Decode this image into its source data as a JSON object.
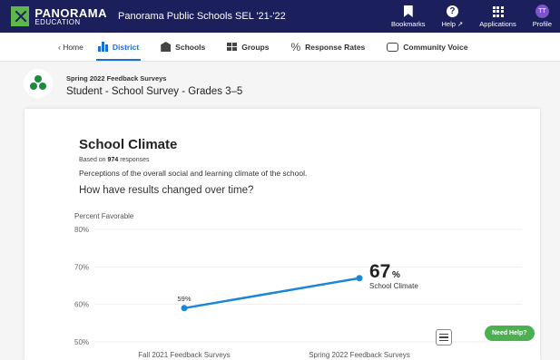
{
  "header": {
    "logo_name": "PANORAMA",
    "logo_sub": "EDUCATION",
    "app_title": "Panorama Public Schools SEL '21-'22",
    "nav": [
      {
        "label": "Bookmarks",
        "icon": "bookmark-icon"
      },
      {
        "label": "Help ↗",
        "icon": "help-icon"
      },
      {
        "label": "Applications",
        "icon": "apps-grid-icon"
      },
      {
        "label": "Profile",
        "icon": "avatar",
        "initials": "TT"
      }
    ]
  },
  "subnav": {
    "home": "‹ Home",
    "items": [
      "District",
      "Schools",
      "Groups",
      "Response Rates",
      "Community Voice"
    ],
    "active": "District"
  },
  "survey": {
    "subtitle": "Spring 2022 Feedback Surveys",
    "title": "Student - School Survey - Grades 3–5"
  },
  "section": {
    "title": "School Climate",
    "based_on_prefix": "Based on",
    "responses_count": "974",
    "based_on_suffix": "responses",
    "description": "Perceptions of the overall social and learning climate of the school.",
    "question": "How have results changed over time?"
  },
  "chart_data": {
    "type": "line",
    "ylabel": "Percent Favorable",
    "ylim": [
      50,
      80
    ],
    "yticks": [
      "80%",
      "70%",
      "60%",
      "50%"
    ],
    "categories": [
      "Fall 2021 Feedback Surveys",
      "Spring 2022 Feedback Surveys"
    ],
    "series": [
      {
        "name": "School Climate",
        "values": [
          59,
          67
        ],
        "color": "#1a87d9"
      }
    ],
    "labels": [
      "59%",
      "67"
    ],
    "latest_unit": "%",
    "latest_label": "School Climate"
  },
  "help_button": "Need Help?"
}
